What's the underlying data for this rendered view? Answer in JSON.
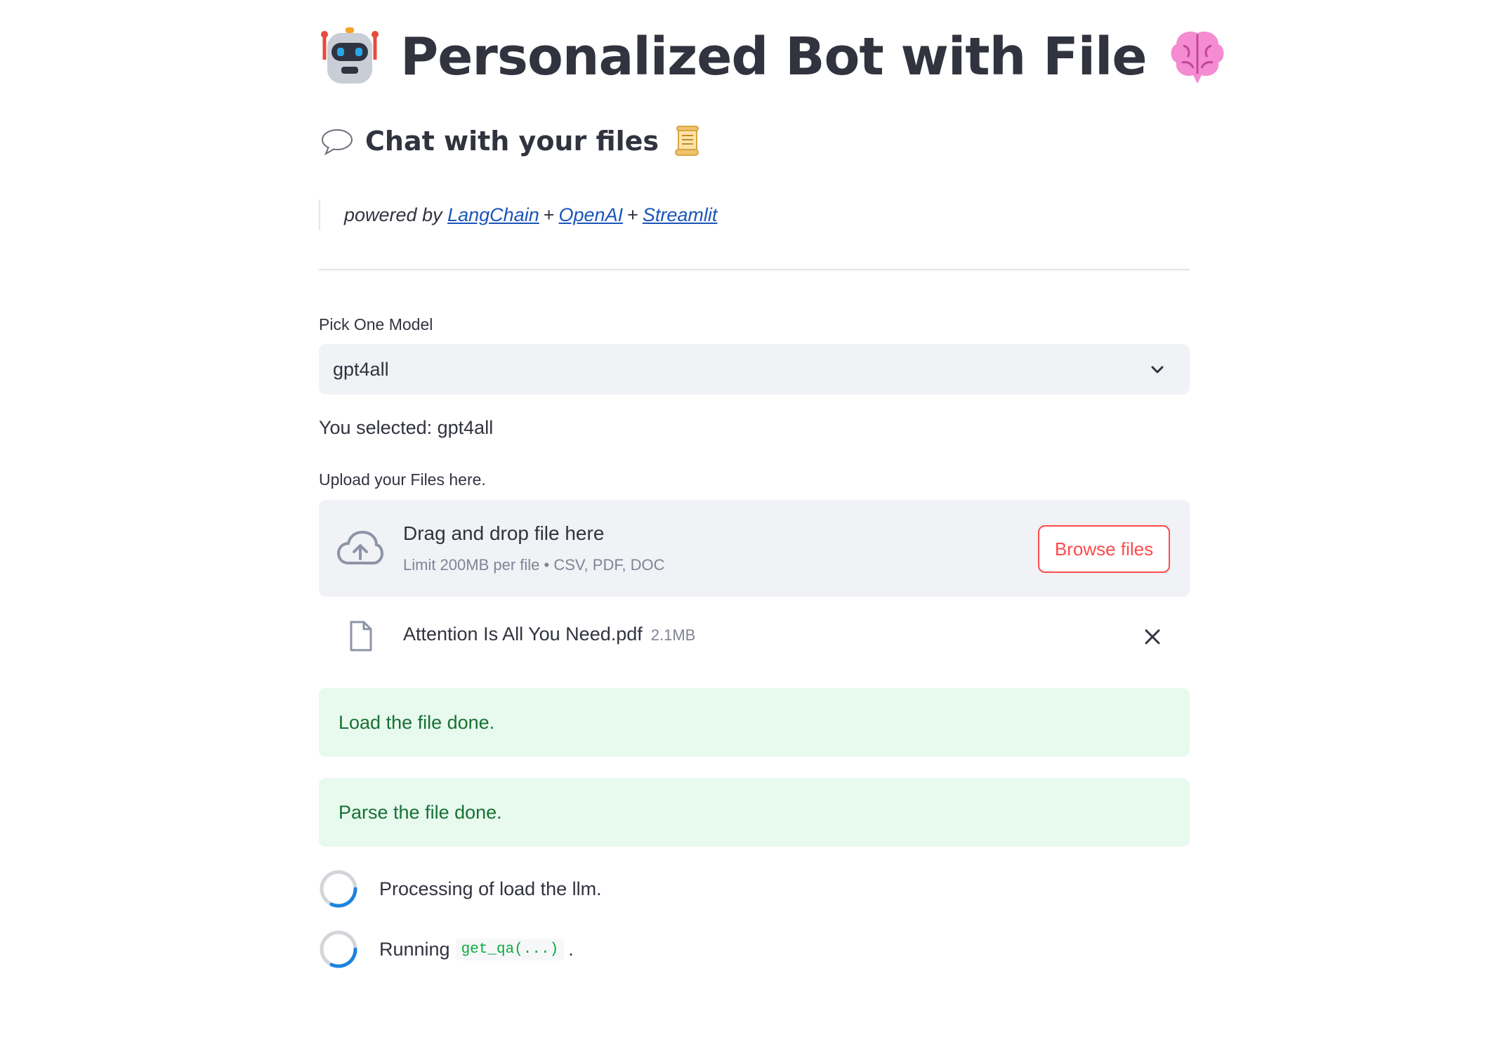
{
  "header": {
    "title": "Personalized Bot with File",
    "title_icon_left": "robot-emoji",
    "title_icon_right": "brain-emoji",
    "subtitle": "Chat with your files",
    "subtitle_icon_left": "speech-bubble-emoji",
    "subtitle_icon_right": "scroll-emoji"
  },
  "credits": {
    "prefix": "powered by",
    "links": [
      "LangChain",
      "OpenAI",
      "Streamlit"
    ],
    "separator": "+"
  },
  "model_select": {
    "label": "Pick One Model",
    "value": "gpt4all",
    "selected_text": "You selected: gpt4all"
  },
  "uploader": {
    "label": "Upload your Files here.",
    "drop_title": "Drag and drop file here",
    "drop_subtitle": "Limit 200MB per file • CSV, PDF, DOC",
    "browse_label": "Browse files",
    "file": {
      "name": "Attention Is All You Need.pdf",
      "size": "2.1MB"
    }
  },
  "alerts": [
    "Load the file done.",
    "Parse the file done."
  ],
  "status": {
    "processing": "Processing of load the llm.",
    "running_prefix": "Running",
    "running_code": "get_qa(...)",
    "running_suffix": "."
  },
  "colors": {
    "accent": "#ff4b4b",
    "success_bg": "#e8f9ee",
    "success_text": "#177233",
    "link": "#1a55b8",
    "input_bg": "#f0f2f6",
    "spinner": "#1c83e1"
  }
}
